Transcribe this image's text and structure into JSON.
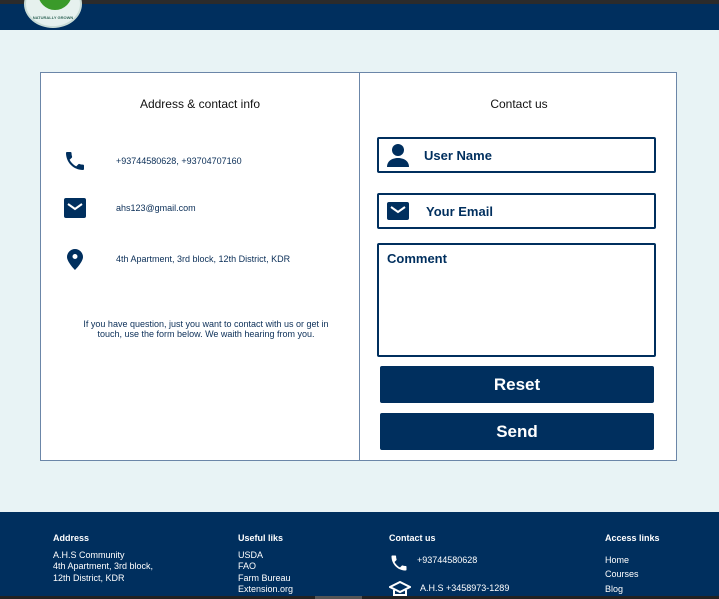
{
  "brand": {
    "logo_text": "NATURALLY GROWN"
  },
  "address_panel": {
    "title": "Address & contact info",
    "phone": "+93744580628,  +93704707160",
    "email": "ahs123@gmail.com",
    "address": "4th Apartment, 3rd block, 12th District, KDR",
    "note": "If you have question, just you want to contact with us or get in touch, use the form below. We waith hearing from you."
  },
  "contact_form": {
    "title": "Contact us",
    "username_placeholder": "User Name",
    "email_placeholder": "Your Email",
    "comment_placeholder": "Comment",
    "reset_label": "Reset",
    "send_label": "Send"
  },
  "footer": {
    "address": {
      "title": "Address",
      "lines": [
        "A.H.S Community",
        "4th Apartment, 3rd block,",
        "12th District, KDR"
      ]
    },
    "useful": {
      "title": "Useful liks",
      "links": [
        "USDA",
        "FAO",
        "Farm Bureau",
        "Extension.org"
      ]
    },
    "contact": {
      "title": "Contact us",
      "phone": "+93744580628",
      "institute": "A.H.S +3458973-1289"
    },
    "access": {
      "title": "Access links",
      "links": [
        "Home",
        "Courses",
        "Blog"
      ]
    }
  },
  "colors": {
    "primary": "#002f5e",
    "background": "#e8f3f5"
  }
}
